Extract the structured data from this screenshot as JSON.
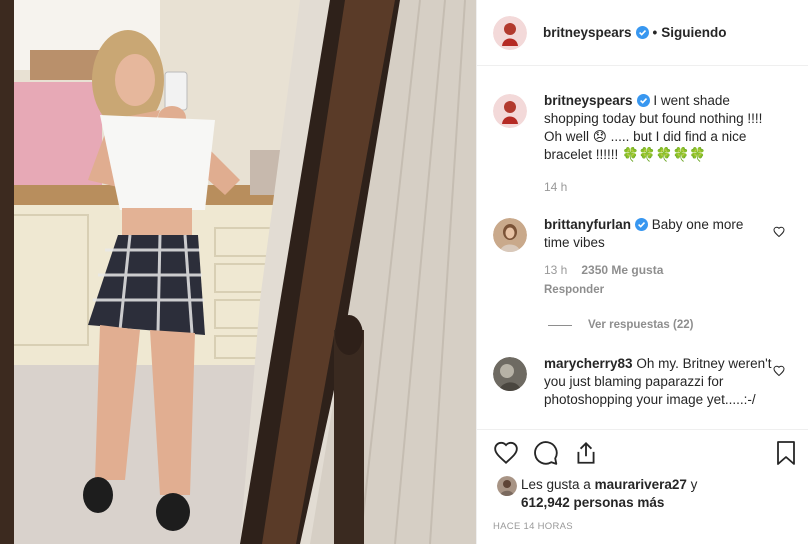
{
  "header": {
    "username": "britneyspears",
    "separator": "•",
    "follow_status": "Siguiendo"
  },
  "caption": {
    "username": "britneyspears",
    "text": "I went shade shopping today but found nothing !!!! Oh well 😞 ..... but I did find a nice bracelet !!!!!! 🍀🍀🍀🍀🍀",
    "time": "14 h"
  },
  "comments": [
    {
      "username": "brittanyfurlan",
      "text": "Baby one more time vibes",
      "time": "13 h",
      "likes": "2350 Me gusta",
      "reply": "Responder",
      "view_replies": "Ver respuestas (22)"
    },
    {
      "username": "marycherry83",
      "text": "Oh my. Britney weren't you just blaming paparazzi for photoshopping your image yet.....:-/"
    }
  ],
  "liked_by": {
    "prefix": "Les gusta a",
    "user": "maurarivera27",
    "conj": "y",
    "count": "612,942 personas más"
  },
  "posted_ago": "HACE 14 HORAS",
  "icons": [
    "heart-icon",
    "comment-icon",
    "share-icon",
    "bookmark-icon",
    "verified-icon"
  ],
  "colors": {
    "verified": "#3897f0",
    "muted": "#8e8e8e",
    "text": "#262626"
  }
}
